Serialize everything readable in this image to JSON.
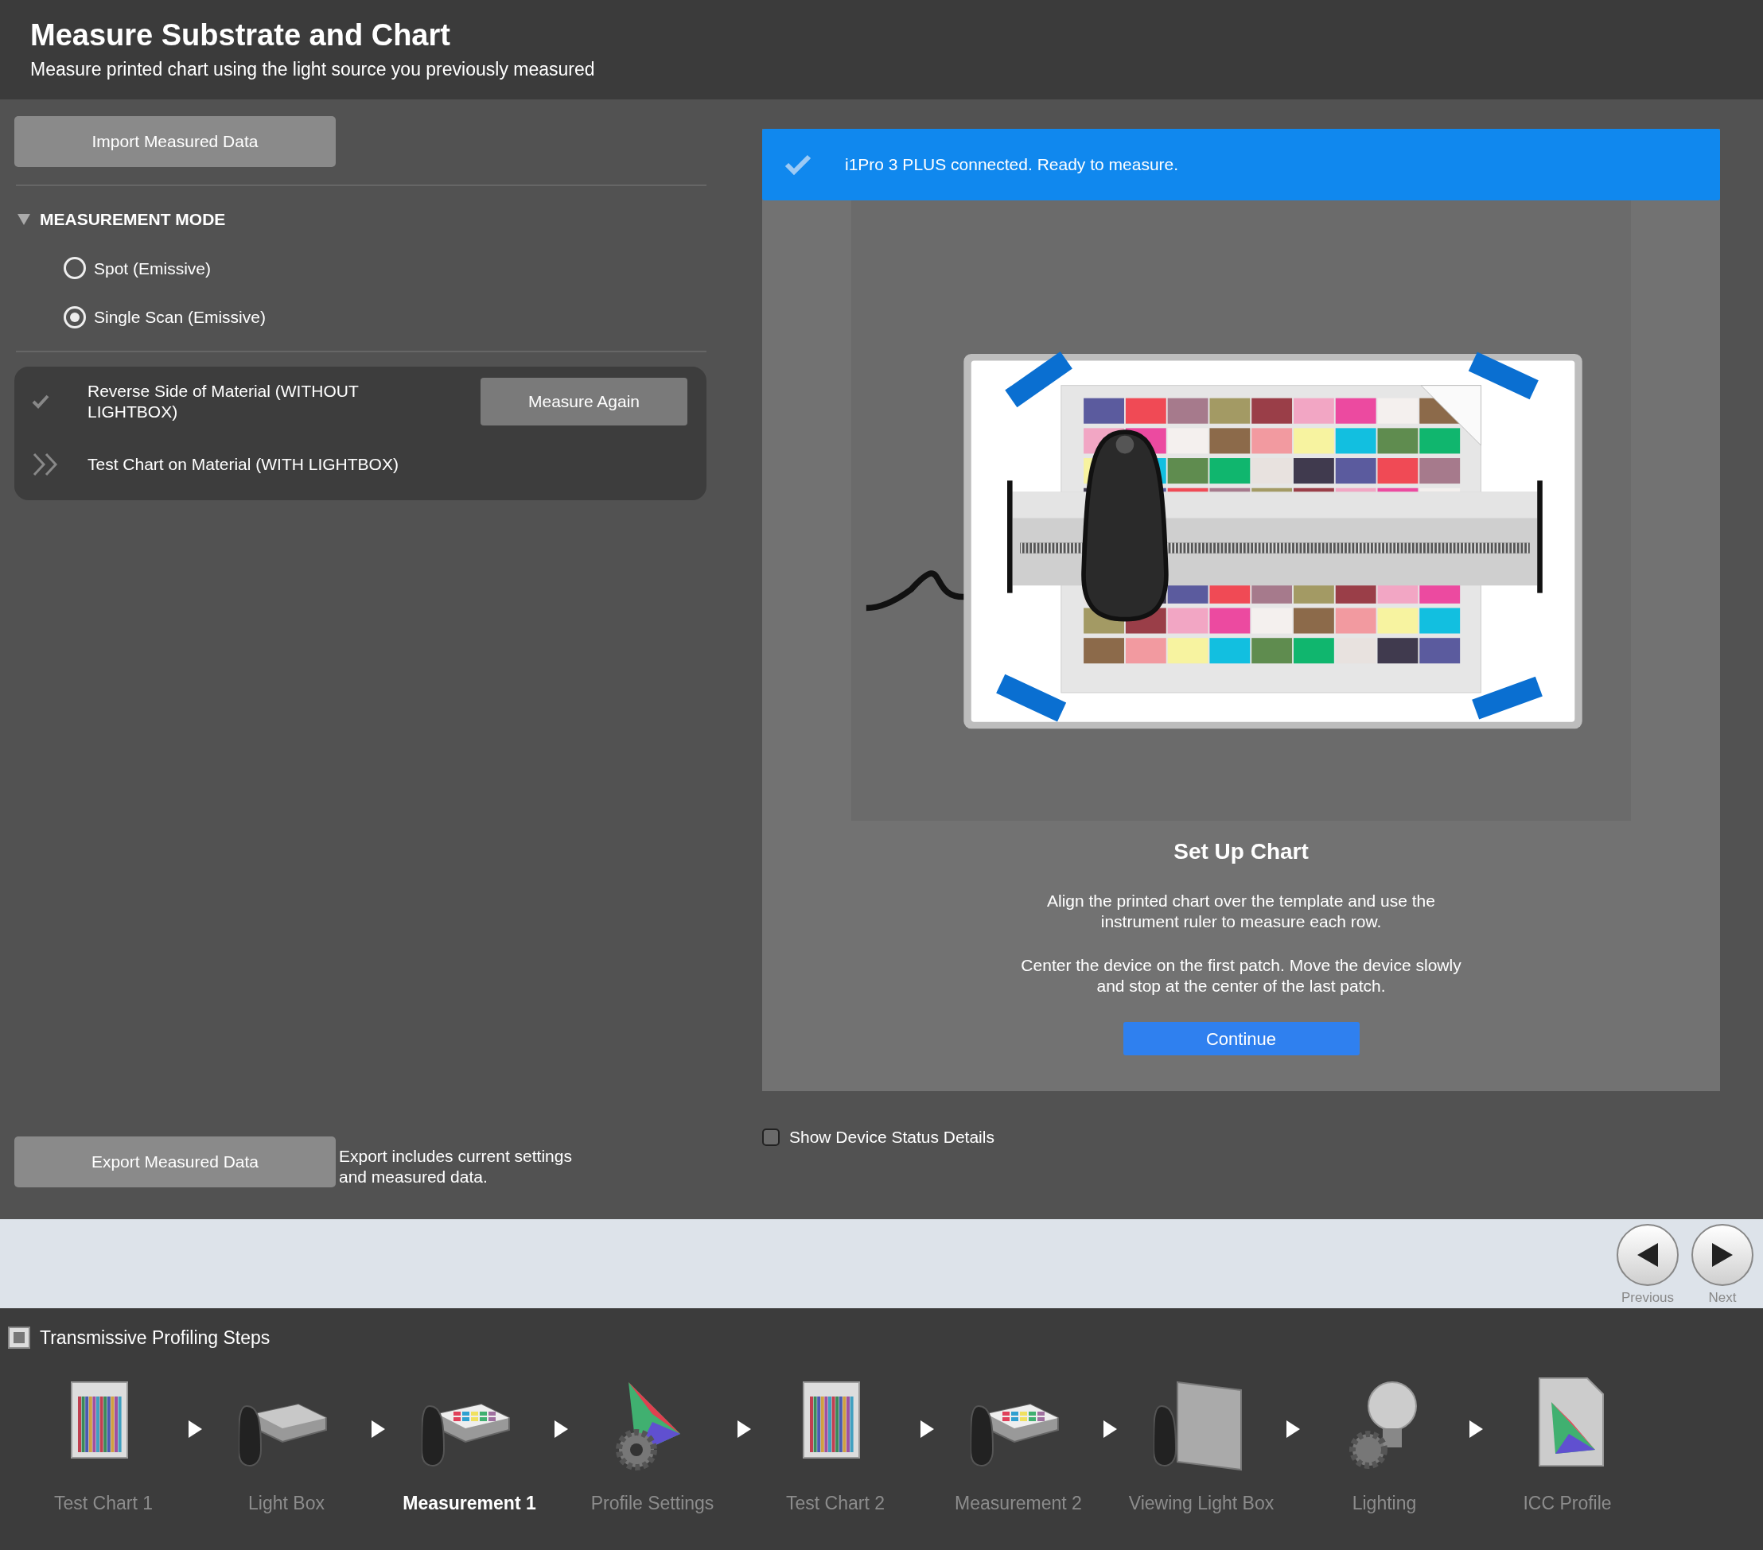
{
  "header": {
    "title": "Measure Substrate and Chart",
    "subtitle": "Measure printed chart using the light source you previously measured"
  },
  "import_button": "Import Measured Data",
  "measurement_mode": {
    "title": "MEASUREMENT MODE",
    "expanded": true,
    "options": [
      {
        "label": "Spot (Emissive)",
        "selected": false
      },
      {
        "label": "Single Scan (Emissive)",
        "selected": true
      }
    ]
  },
  "measurement_steps": [
    {
      "label": "Reverse Side of Material (WITHOUT LIGHTBOX)",
      "kind": "done",
      "button": "Measure Again"
    },
    {
      "label": "Test Chart on Material (WITH LIGHTBOX)",
      "kind": "current"
    }
  ],
  "status_banner": {
    "text": "i1Pro 3 PLUS connected. Ready to measure."
  },
  "instructions": {
    "title": "Set Up Chart",
    "paragraphs": [
      "Align the printed chart over the template and use the instrument ruler to measure each row.",
      "Center the device on the first patch. Move the device slowly and stop at the center of the last patch."
    ],
    "button": "Continue"
  },
  "device_status_checkbox": {
    "label": "Show Device Status Details",
    "checked": false
  },
  "export": {
    "button": "Export Measured Data",
    "note": "Export includes current settings and measured data."
  },
  "navigation": [
    {
      "kind": "previous",
      "label": "Previous"
    },
    {
      "kind": "next",
      "label": "Next"
    }
  ],
  "profiling_steps": {
    "title": "Transmissive Profiling Steps",
    "steps": [
      {
        "label": "Test Chart 1",
        "kind": "chart",
        "selected": false
      },
      {
        "label": "Light Box",
        "kind": "lightbox",
        "selected": false
      },
      {
        "label": "Measurement 1",
        "kind": "measurement",
        "selected": true
      },
      {
        "label": "Profile Settings",
        "kind": "settings",
        "selected": false
      },
      {
        "label": "Test Chart 2",
        "kind": "chart",
        "selected": false
      },
      {
        "label": "Measurement 2",
        "kind": "measurement",
        "selected": false
      },
      {
        "label": "Viewing Light Box",
        "kind": "viewing",
        "selected": false
      },
      {
        "label": "Lighting",
        "kind": "lighting",
        "selected": false
      },
      {
        "label": "ICC Profile",
        "kind": "icc",
        "selected": false
      }
    ]
  }
}
